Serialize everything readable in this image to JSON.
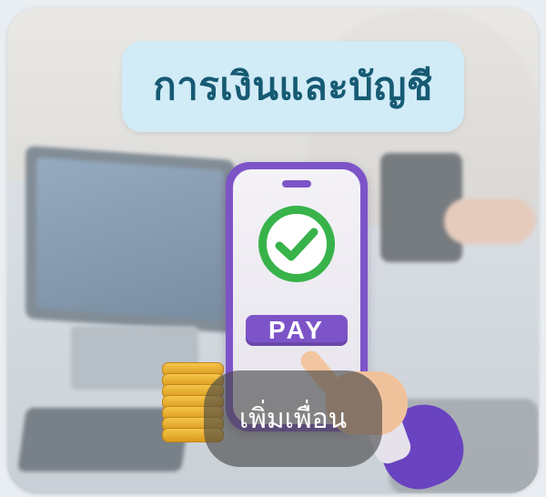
{
  "card": {
    "title": "การเงินและบัญชี",
    "illustration": {
      "pay_label": "PAY",
      "check_icon": "check-circle-icon",
      "accent_color": "#7d54c8",
      "check_color": "#37b34a"
    },
    "action": {
      "label": "เพิ่มเพื่อน"
    }
  }
}
